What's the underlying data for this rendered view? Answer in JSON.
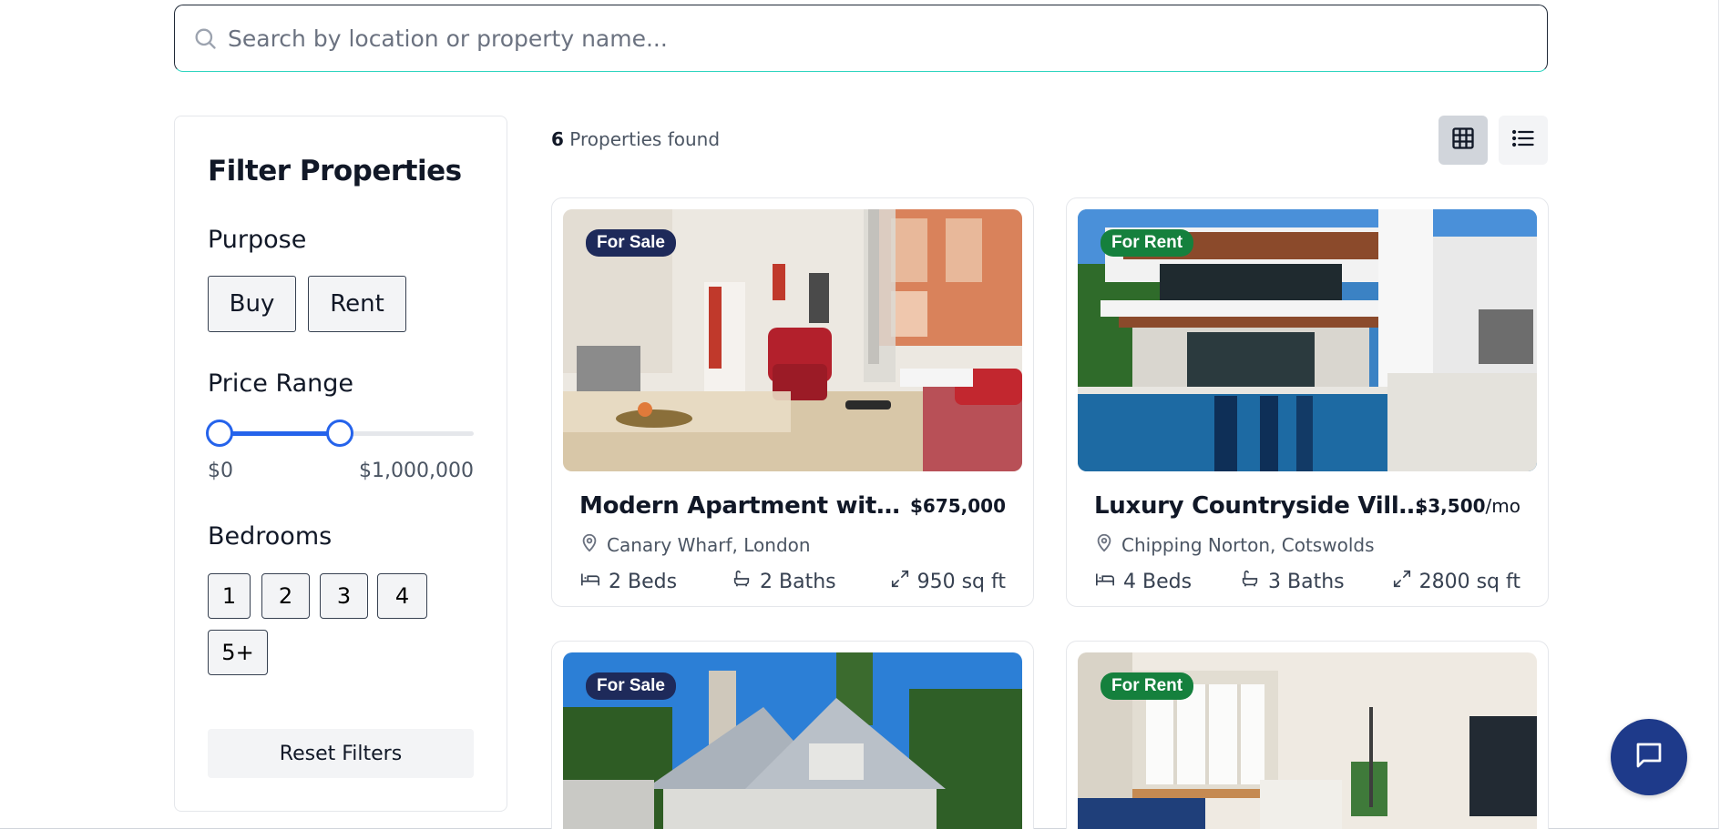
{
  "search": {
    "placeholder": "Search by location or property name..."
  },
  "filters": {
    "title": "Filter Properties",
    "purpose_label": "Purpose",
    "purpose_options": [
      "Buy",
      "Rent"
    ],
    "price_label": "Price Range",
    "price_min_label": "$0",
    "price_max_label": "$1,000,000",
    "price_selected_fraction": [
      0,
      0.45
    ],
    "bedrooms_label": "Bedrooms",
    "bedroom_options": [
      "1",
      "2",
      "3",
      "4",
      "5+"
    ],
    "reset_label": "Reset Filters"
  },
  "results": {
    "count": "6",
    "count_label": "Properties found",
    "view_mode": "grid"
  },
  "properties": [
    {
      "badge": "For Sale",
      "title": "Modern Apartment with Riv...",
      "price": "$675,000",
      "price_suffix": "",
      "location": "Canary Wharf, London",
      "beds": "2 Beds",
      "baths": "2 Baths",
      "area": "950 sq ft"
    },
    {
      "badge": "For Rent",
      "title": "Luxury Countryside Villa...",
      "price": "$3,500",
      "price_suffix": "/mo",
      "location": "Chipping Norton, Cotswolds",
      "beds": "4 Beds",
      "baths": "3 Baths",
      "area": "2800 sq ft"
    },
    {
      "badge": "For Sale"
    },
    {
      "badge": "For Rent"
    }
  ],
  "colors": {
    "accent": "#2563eb",
    "sale_badge": "#1e2a5a",
    "rent_badge": "#15803d",
    "chat_button": "#1e3a8a"
  }
}
